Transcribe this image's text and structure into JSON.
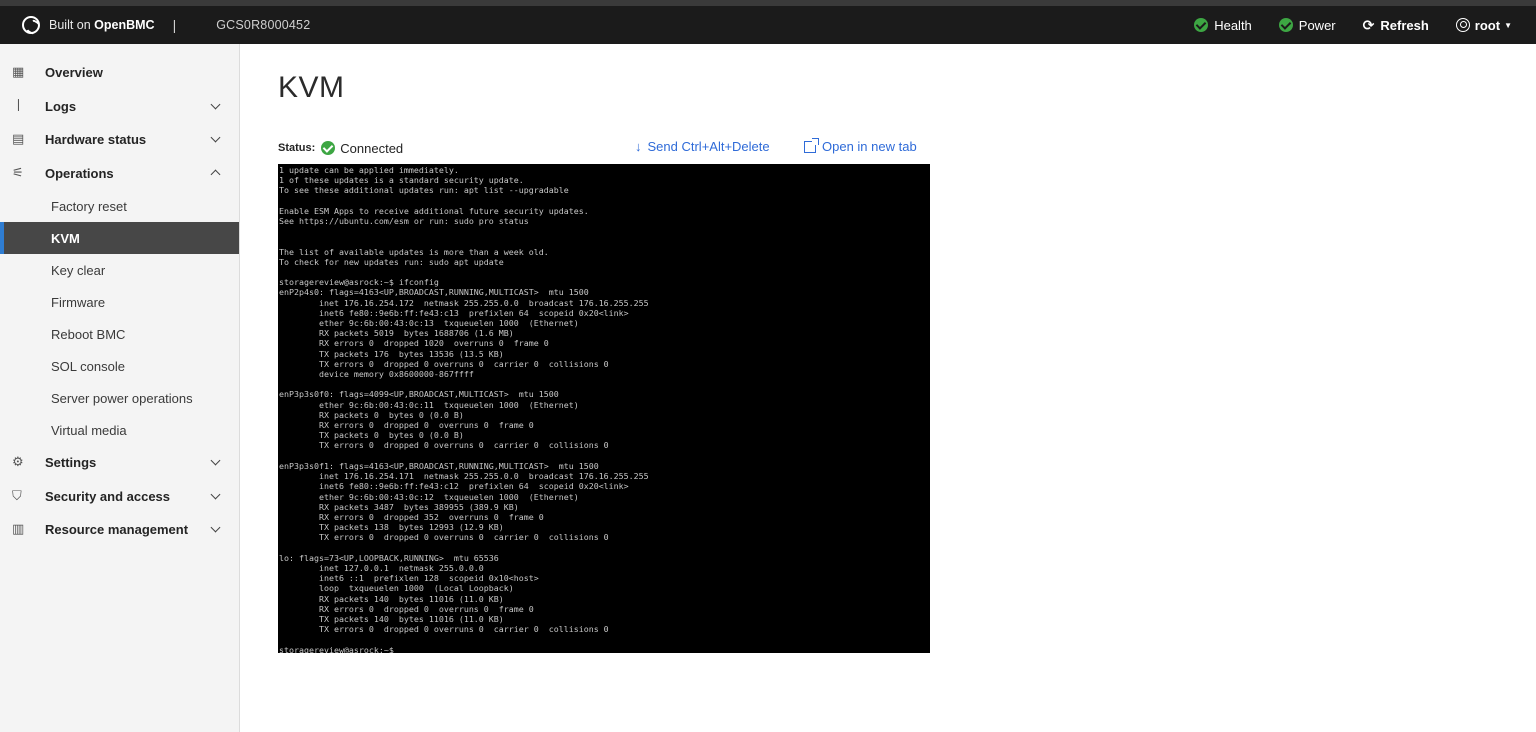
{
  "header": {
    "brand_prefix": "Built on ",
    "brand_name": "OpenBMC",
    "separator": "|",
    "serial": "GCS0R8000452",
    "health_label": "Health",
    "power_label": "Power",
    "refresh_label": "Refresh",
    "user_label": "root"
  },
  "sidebar": {
    "items": [
      {
        "label": "Overview",
        "icon": "overview-icon"
      },
      {
        "label": "Logs",
        "icon": "logs-icon"
      },
      {
        "label": "Hardware status",
        "icon": "hardware-icon"
      },
      {
        "label": "Operations",
        "icon": "operations-icon"
      },
      {
        "label": "Settings",
        "icon": "gear-icon"
      },
      {
        "label": "Security and access",
        "icon": "shield-icon"
      },
      {
        "label": "Resource management",
        "icon": "resource-icon"
      }
    ],
    "operations_subitems": [
      "Factory reset",
      "KVM",
      "Key clear",
      "Firmware",
      "Reboot BMC",
      "SOL console",
      "Server power operations",
      "Virtual media"
    ],
    "active_subitem": "KVM"
  },
  "main": {
    "title": "KVM",
    "status_label": "Status:",
    "status_value": "Connected",
    "send_ctrl_alt_delete_label": "Send Ctrl+Alt+Delete",
    "open_new_tab_label": "Open in new tab"
  },
  "console": {
    "text": "1 update can be applied immediately.\n1 of these updates is a standard security update.\nTo see these additional updates run: apt list --upgradable\n\nEnable ESM Apps to receive additional future security updates.\nSee https://ubuntu.com/esm or run: sudo pro status\n\n\nThe list of available updates is more than a week old.\nTo check for new updates run: sudo apt update\n\nstoragereview@asrock:~$ ifconfig\nenP2p4s0: flags=4163<UP,BROADCAST,RUNNING,MULTICAST>  mtu 1500\n        inet 176.16.254.172  netmask 255.255.0.0  broadcast 176.16.255.255\n        inet6 fe80::9e6b:ff:fe43:c13  prefixlen 64  scopeid 0x20<link>\n        ether 9c:6b:00:43:0c:13  txqueuelen 1000  (Ethernet)\n        RX packets 5019  bytes 1688706 (1.6 MB)\n        RX errors 0  dropped 1020  overruns 0  frame 0\n        TX packets 176  bytes 13536 (13.5 KB)\n        TX errors 0  dropped 0 overruns 0  carrier 0  collisions 0\n        device memory 0x8600000-867ffff\n\nenP3p3s0f0: flags=4099<UP,BROADCAST,MULTICAST>  mtu 1500\n        ether 9c:6b:00:43:0c:11  txqueuelen 1000  (Ethernet)\n        RX packets 0  bytes 0 (0.0 B)\n        RX errors 0  dropped 0  overruns 0  frame 0\n        TX packets 0  bytes 0 (0.0 B)\n        TX errors 0  dropped 0 overruns 0  carrier 0  collisions 0\n\nenP3p3s0f1: flags=4163<UP,BROADCAST,RUNNING,MULTICAST>  mtu 1500\n        inet 176.16.254.171  netmask 255.255.0.0  broadcast 176.16.255.255\n        inet6 fe80::9e6b:ff:fe43:c12  prefixlen 64  scopeid 0x20<link>\n        ether 9c:6b:00:43:0c:12  txqueuelen 1000  (Ethernet)\n        RX packets 3487  bytes 389955 (389.9 KB)\n        RX errors 0  dropped 352  overruns 0  frame 0\n        TX packets 138  bytes 12993 (12.9 KB)\n        TX errors 0  dropped 0 overruns 0  carrier 0  collisions 0\n\nlo: flags=73<UP,LOOPBACK,RUNNING>  mtu 65536\n        inet 127.0.0.1  netmask 255.0.0.0\n        inet6 ::1  prefixlen 128  scopeid 0x10<host>\n        loop  txqueuelen 1000  (Local Loopback)\n        RX packets 140  bytes 11016 (11.0 KB)\n        RX errors 0  dropped 0  overruns 0  frame 0\n        TX packets 140  bytes 11016 (11.0 KB)\n        TX errors 0  dropped 0 overruns 0  carrier 0  collisions 0\n\nstoragereview@asrock:~$ _"
  },
  "colors": {
    "topbar": "#1b1b1b",
    "sidebar": "#f4f4f4",
    "active_item": "#474747",
    "active_accent": "#2f7dd2",
    "link": "#2f6bd8",
    "success": "#3da643",
    "console_bg": "#000000"
  }
}
